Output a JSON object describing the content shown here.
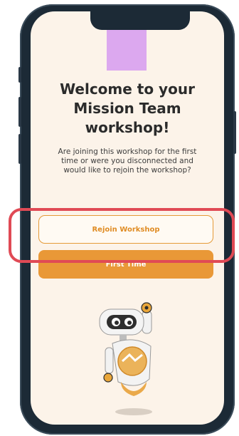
{
  "screen": {
    "title": "Welcome to your Mission Team workshop!",
    "subtitle": "Are joining this workshop for the first time or were you disconnected and would like to rejoin the workshop?",
    "buttons": {
      "rejoin_label": "Rejoin Workshop",
      "first_time_label": "First Time"
    }
  },
  "colors": {
    "background": "#fcf3e9",
    "accent": "#e99837",
    "logo_placeholder": "#dca8ef",
    "highlight": "#e04a55",
    "phone_frame": "#1c2a36"
  },
  "icons": {
    "logo": "logo-placeholder",
    "mascot": "robot-mascot"
  }
}
